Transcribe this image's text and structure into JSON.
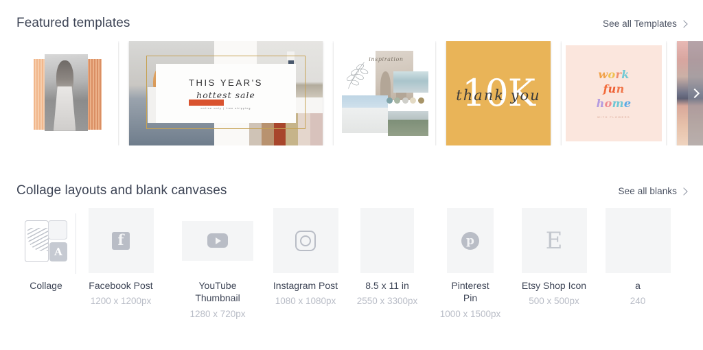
{
  "featured": {
    "title": "Featured templates",
    "see_all_label": "See all Templates",
    "see_all_icon": "chevron-right-icon",
    "next_icon": "chevron-right-icon",
    "cards": [
      {
        "name": "brush-portrait-template",
        "kind": "square-photo-brush",
        "colors": [
          "#f0b183",
          "#d98a5c"
        ]
      },
      {
        "name": "hottest-sale-template",
        "kind": "wide-sale-banner",
        "headline": "THIS YEAR'S",
        "script": "hottest sale",
        "caption": "online only | free shipping",
        "frame_color": "#c6a253",
        "swatches": [
          "#cfc3b6",
          "#b8926f",
          "#a8462c",
          "#c6b48a",
          "#e4d6cc",
          "#d8c2bc"
        ]
      },
      {
        "name": "moodboard-template",
        "kind": "moodboard",
        "script": "inspiration",
        "palette": [
          "#7fa3a8",
          "#a8b6a4",
          "#cfcfca",
          "#e3dac4",
          "#a79468"
        ]
      },
      {
        "name": "thank-you-10k-template",
        "kind": "milestone-card",
        "headline": "10K",
        "script": "thank you",
        "background": "#e9b458"
      },
      {
        "name": "work-fun-home-template",
        "kind": "typography-card",
        "background": "#fbe6dd",
        "lines": [
          {
            "text": "work",
            "letters": [
              {
                "c": "w",
                "color": "#f1a24a"
              },
              {
                "c": "o",
                "color": "#efc14f"
              },
              {
                "c": "r",
                "color": "#ef8e6e"
              },
              {
                "c": "k",
                "color": "#6fc9d4"
              }
            ]
          },
          {
            "text": "fun",
            "letters": [
              {
                "c": "f",
                "color": "#f26b3a"
              },
              {
                "c": "u",
                "color": "#ee5f33"
              },
              {
                "c": "n",
                "color": "#f0764a"
              }
            ]
          },
          {
            "text": "home",
            "letters": [
              {
                "c": "h",
                "color": "#b39ae0"
              },
              {
                "c": "o",
                "color": "#f08a8f"
              },
              {
                "c": "m",
                "color": "#6ec7d6"
              },
              {
                "c": "e",
                "color": "#5aa9e6"
              }
            ]
          }
        ],
        "caption": "WITH FLOWERS"
      },
      {
        "name": "sunset-template",
        "kind": "partial-photo"
      }
    ]
  },
  "blanks": {
    "title": "Collage layouts and blank canvases",
    "see_all_label": "See all blanks",
    "see_all_icon": "chevron-right-icon",
    "items": [
      {
        "name": "collage",
        "label": "Collage",
        "dims": "",
        "icon": "collage-icon",
        "tw": 0,
        "th": 0
      },
      {
        "name": "facebook-post",
        "label": "Facebook Post",
        "dims": "1200 x 1200px",
        "icon": "facebook-icon",
        "tw": 95,
        "th": 95
      },
      {
        "name": "youtube-thumbnail",
        "label": "YouTube Thumbnail",
        "dims": "1280 x 720px",
        "icon": "youtube-icon",
        "tw": 104,
        "th": 58
      },
      {
        "name": "instagram-post",
        "label": "Instagram Post",
        "dims": "1080 x 1080px",
        "icon": "instagram-icon",
        "tw": 95,
        "th": 95
      },
      {
        "name": "letter-page",
        "label": "8.5 x 11 in",
        "dims": "2550 x 3300px",
        "icon": "blank-page-icon",
        "tw": 78,
        "th": 95
      },
      {
        "name": "pinterest-pin",
        "label": "Pinterest Pin",
        "dims": "1000 x 1500px",
        "icon": "pinterest-icon",
        "tw": 68,
        "th": 95
      },
      {
        "name": "etsy-shop-icon",
        "label": "Etsy Shop Icon",
        "dims": "500 x 500px",
        "icon": "etsy-icon",
        "tw": 95,
        "th": 95
      },
      {
        "name": "partial-next-blank",
        "label": "a",
        "dims": "240",
        "icon": "blank-page-icon",
        "tw": 95,
        "th": 95
      }
    ]
  }
}
